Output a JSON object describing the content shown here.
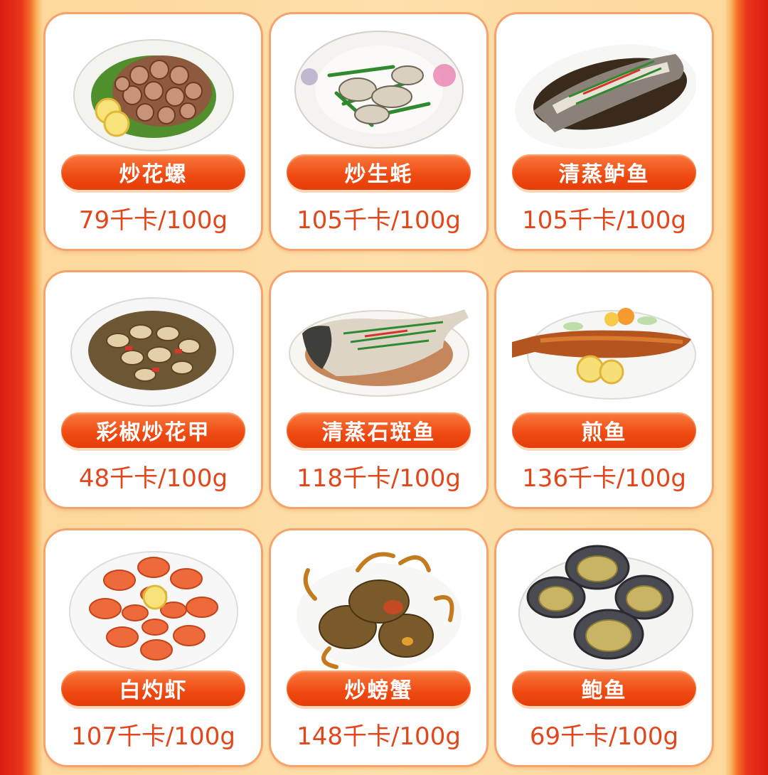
{
  "colors": {
    "frame_red": "#d91e0f",
    "panel_bg": "#fde0aa",
    "pill_orange": "#ef4a12",
    "calorie_text": "#e2461a",
    "card_border": "#f5a36b"
  },
  "dishes": [
    {
      "name": "炒花螺",
      "calories": "79千卡/100g",
      "icon": "sea-snail-dish-photo"
    },
    {
      "name": "炒生蚝",
      "calories": "105千卡/100g",
      "icon": "oyster-dish-photo"
    },
    {
      "name": "清蒸鲈鱼",
      "calories": "105千卡/100g",
      "icon": "steamed-bass-photo"
    },
    {
      "name": "彩椒炒花甲",
      "calories": "48千卡/100g",
      "icon": "clam-dish-photo"
    },
    {
      "name": "清蒸石斑鱼",
      "calories": "118千卡/100g",
      "icon": "steamed-grouper-photo"
    },
    {
      "name": "煎鱼",
      "calories": "136千卡/100g",
      "icon": "fried-fish-photo"
    },
    {
      "name": "白灼虾",
      "calories": "107千卡/100g",
      "icon": "boiled-shrimp-photo"
    },
    {
      "name": "炒螃蟹",
      "calories": "148千卡/100g",
      "icon": "fried-crab-photo"
    },
    {
      "name": "鲍鱼",
      "calories": "69千卡/100g",
      "icon": "abalone-photo"
    }
  ]
}
